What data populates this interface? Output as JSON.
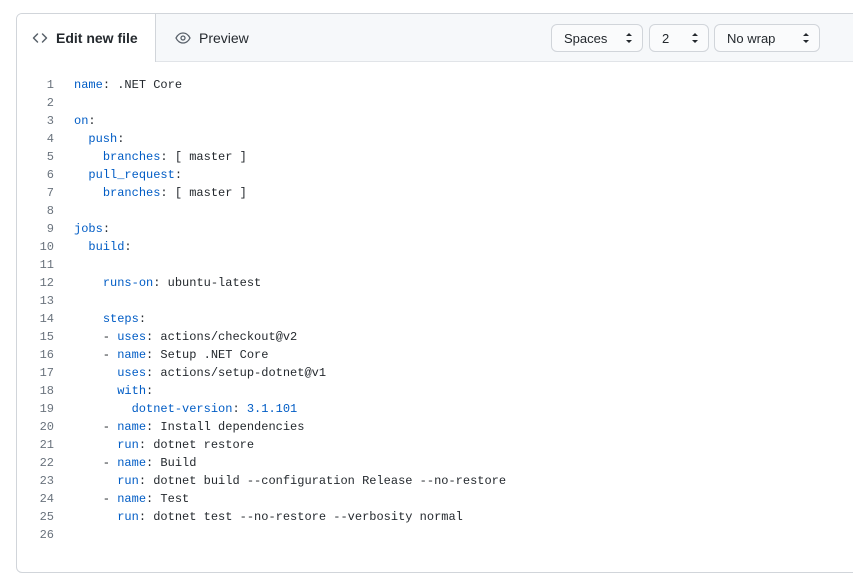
{
  "tabs": {
    "edit_label": "Edit new file",
    "preview_label": "Preview"
  },
  "controls": {
    "indent_mode": "Spaces",
    "indent_size": "2",
    "wrap_mode": "No wrap"
  },
  "code_lines": [
    [
      [
        "k",
        "name"
      ],
      [
        "t",
        ": .NET Core"
      ]
    ],
    [],
    [
      [
        "k",
        "on"
      ],
      [
        "t",
        ":"
      ]
    ],
    [
      [
        "t",
        "  "
      ],
      [
        "k",
        "push"
      ],
      [
        "t",
        ":"
      ]
    ],
    [
      [
        "t",
        "    "
      ],
      [
        "k",
        "branches"
      ],
      [
        "t",
        ": [ master ]"
      ]
    ],
    [
      [
        "t",
        "  "
      ],
      [
        "k",
        "pull_request"
      ],
      [
        "t",
        ":"
      ]
    ],
    [
      [
        "t",
        "    "
      ],
      [
        "k",
        "branches"
      ],
      [
        "t",
        ": [ master ]"
      ]
    ],
    [],
    [
      [
        "k",
        "jobs"
      ],
      [
        "t",
        ":"
      ]
    ],
    [
      [
        "t",
        "  "
      ],
      [
        "k",
        "build"
      ],
      [
        "t",
        ":"
      ]
    ],
    [],
    [
      [
        "t",
        "    "
      ],
      [
        "k",
        "runs-on"
      ],
      [
        "t",
        ": ubuntu-latest"
      ]
    ],
    [],
    [
      [
        "t",
        "    "
      ],
      [
        "k",
        "steps"
      ],
      [
        "t",
        ":"
      ]
    ],
    [
      [
        "t",
        "    - "
      ],
      [
        "k",
        "uses"
      ],
      [
        "t",
        ": actions/checkout@v2"
      ]
    ],
    [
      [
        "t",
        "    - "
      ],
      [
        "k",
        "name"
      ],
      [
        "t",
        ": Setup .NET Core"
      ]
    ],
    [
      [
        "t",
        "      "
      ],
      [
        "k",
        "uses"
      ],
      [
        "t",
        ": actions/setup-dotnet@v1"
      ]
    ],
    [
      [
        "t",
        "      "
      ],
      [
        "k",
        "with"
      ],
      [
        "t",
        ":"
      ]
    ],
    [
      [
        "t",
        "        "
      ],
      [
        "k",
        "dotnet-version"
      ],
      [
        "t",
        ": "
      ],
      [
        "n",
        "3.1.101"
      ]
    ],
    [
      [
        "t",
        "    - "
      ],
      [
        "k",
        "name"
      ],
      [
        "t",
        ": Install dependencies"
      ]
    ],
    [
      [
        "t",
        "      "
      ],
      [
        "k",
        "run"
      ],
      [
        "t",
        ": dotnet restore"
      ]
    ],
    [
      [
        "t",
        "    - "
      ],
      [
        "k",
        "name"
      ],
      [
        "t",
        ": Build"
      ]
    ],
    [
      [
        "t",
        "      "
      ],
      [
        "k",
        "run"
      ],
      [
        "t",
        ": dotnet build --configuration Release --no-restore"
      ]
    ],
    [
      [
        "t",
        "    - "
      ],
      [
        "k",
        "name"
      ],
      [
        "t",
        ": Test"
      ]
    ],
    [
      [
        "t",
        "      "
      ],
      [
        "k",
        "run"
      ],
      [
        "t",
        ": dotnet test --no-restore --verbosity normal"
      ]
    ],
    []
  ]
}
